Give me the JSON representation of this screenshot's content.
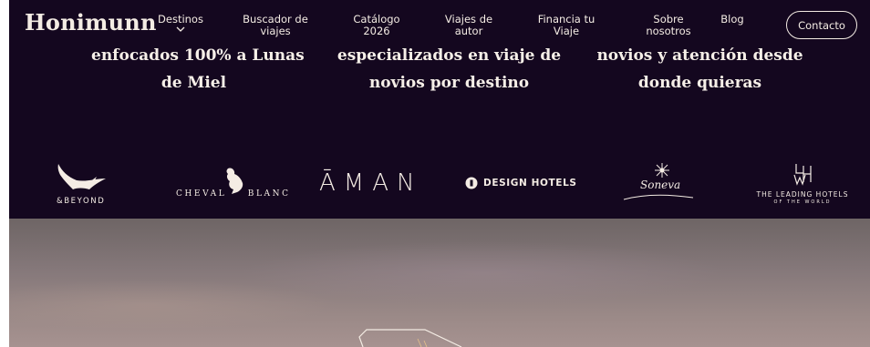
{
  "nav": {
    "logo": "Honimunn",
    "items": [
      {
        "label": "Destinos"
      },
      {
        "label": "Buscador de viajes"
      },
      {
        "label": "Catálogo 2026"
      },
      {
        "label": "Viajes de autor"
      },
      {
        "label": "Financia tu Viaje"
      },
      {
        "label": "Sobre nosotros"
      },
      {
        "label": "Blog"
      }
    ],
    "contact": "Contacto"
  },
  "features": [
    {
      "line1": "enfocados 100% a Lunas",
      "line2": "de Miel"
    },
    {
      "line1": "especializados en viaje de",
      "line2": "novios por destino"
    },
    {
      "line1": "novios y atención desde",
      "line2": "donde quieras"
    }
  ],
  "brands": {
    "andbeyond": "&BEYOND",
    "cheval": "CHEVAL BLANC",
    "aman": "ĀMAN",
    "design_hotels": "DESIGN HOTELS",
    "soneva": "Soneva",
    "leading_1": "THE LEADING HOTELS",
    "leading_2": "OF THE WORLD"
  },
  "colors": {
    "background": "#14071f",
    "text": "#f4ece4"
  }
}
